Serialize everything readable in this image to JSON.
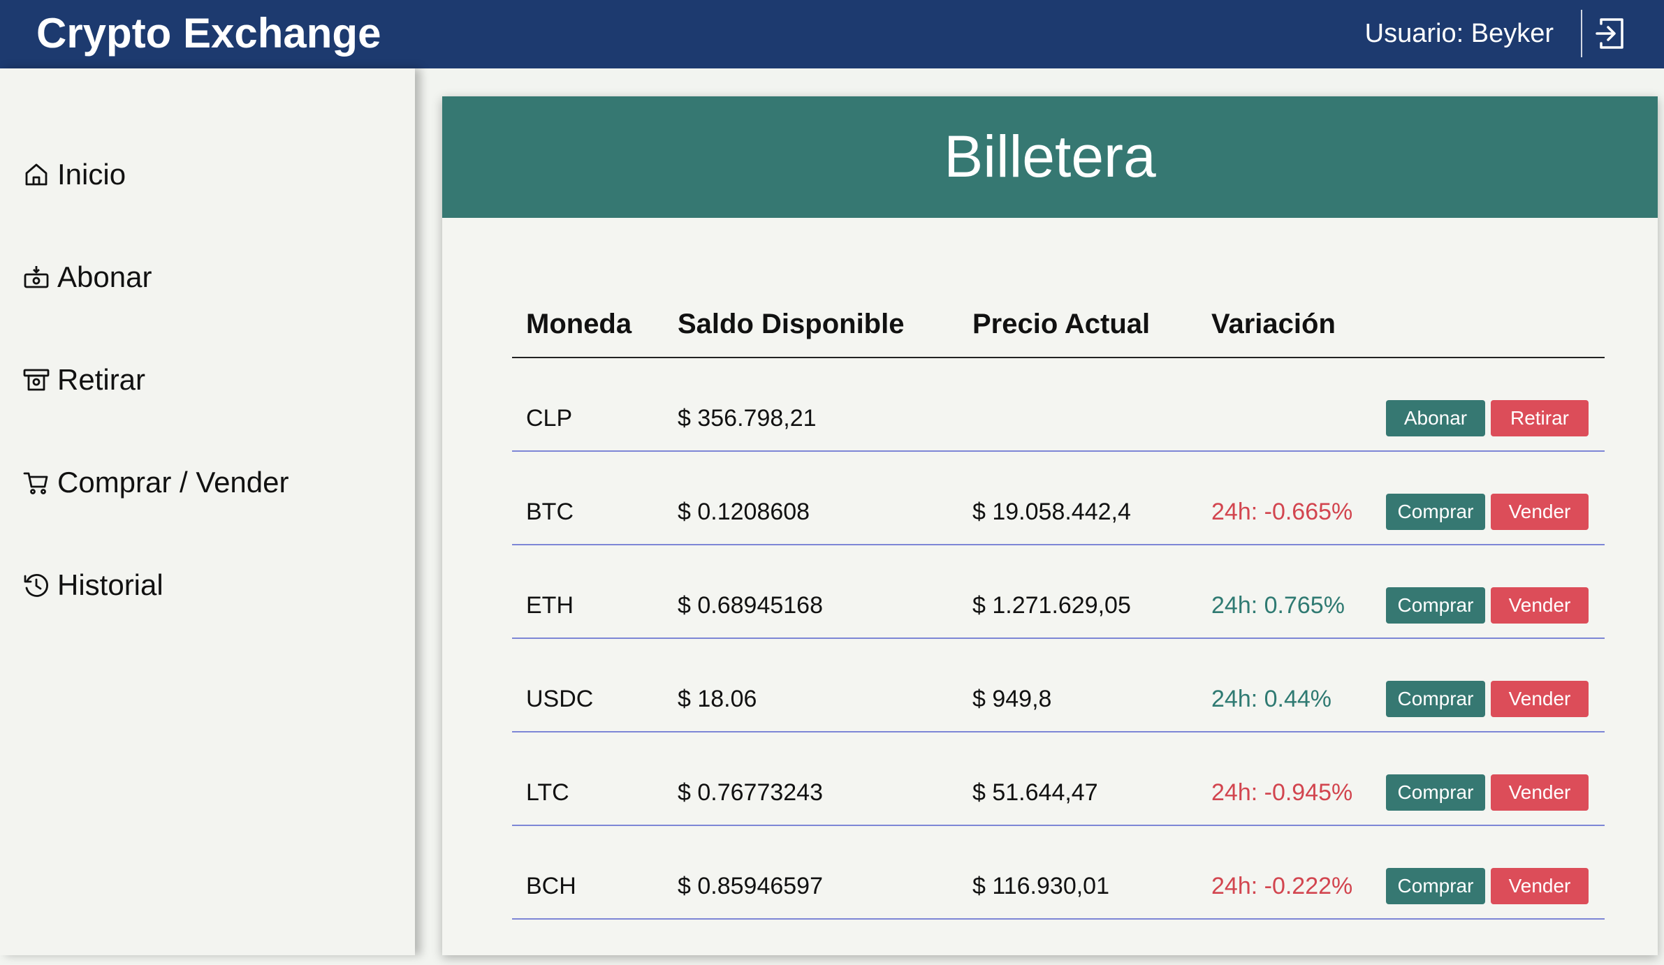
{
  "header": {
    "brand": "Crypto Exchange",
    "user_label": "Usuario: Beyker"
  },
  "sidebar": {
    "items": [
      {
        "label": "Inicio",
        "icon": "home-icon"
      },
      {
        "label": "Abonar",
        "icon": "deposit-icon"
      },
      {
        "label": "Retirar",
        "icon": "withdraw-icon"
      },
      {
        "label": "Comprar / Vender",
        "icon": "cart-icon"
      },
      {
        "label": "Historial",
        "icon": "history-icon"
      }
    ]
  },
  "wallet": {
    "title": "Billetera",
    "columns": [
      "Moneda",
      "Saldo Disponible",
      "Precio Actual",
      "Variación"
    ],
    "rows": [
      {
        "coin": "CLP",
        "balance": "$ 356.798,21",
        "price": "",
        "variation": "",
        "btn1": "Abonar",
        "btn2": "Retirar"
      },
      {
        "coin": "BTC",
        "balance": "$ 0.1208608",
        "price": "$ 19.058.442,4",
        "variation": "24h: -0.665%",
        "btn1": "Comprar",
        "btn2": "Vender"
      },
      {
        "coin": "ETH",
        "balance": "$ 0.68945168",
        "price": "$ 1.271.629,05",
        "variation": "24h: 0.765%",
        "btn1": "Comprar",
        "btn2": "Vender"
      },
      {
        "coin": "USDC",
        "balance": "$ 18.06",
        "price": "$ 949,8",
        "variation": "24h: 0.44%",
        "btn1": "Comprar",
        "btn2": "Vender"
      },
      {
        "coin": "LTC",
        "balance": "$ 0.76773243",
        "price": "$ 51.644,47",
        "variation": "24h: -0.945%",
        "btn1": "Comprar",
        "btn2": "Vender"
      },
      {
        "coin": "BCH",
        "balance": "$ 0.85946597",
        "price": "$ 116.930,01",
        "variation": "24h: -0.222%",
        "btn1": "Comprar",
        "btn2": "Vender"
      }
    ]
  },
  "colors": {
    "header_bg": "#1d3a6f",
    "card_header_bg": "#367872",
    "primary_button": "#367872",
    "danger_button": "#dc4d59",
    "positive_text": "#2f7a72",
    "negative_text": "#d2454f"
  }
}
